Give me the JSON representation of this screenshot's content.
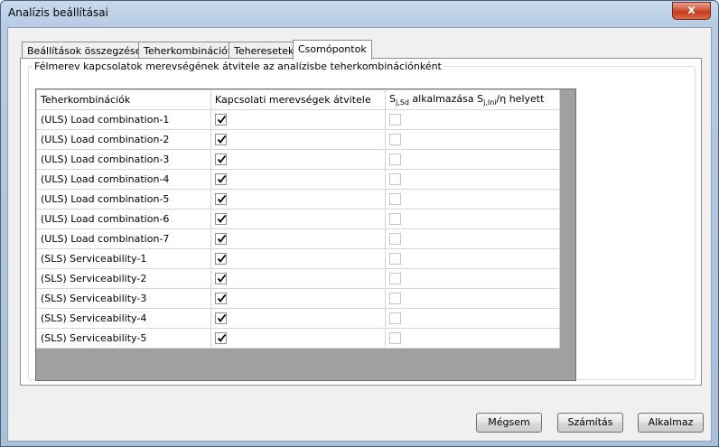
{
  "window": {
    "title": "Analízis beállításai",
    "close_glyph": "x"
  },
  "tabs": [
    {
      "label": "Beállítások összegzése",
      "active": false
    },
    {
      "label": "Teherkombinációk",
      "active": false
    },
    {
      "label": "Teheresetek",
      "active": false
    },
    {
      "label": "Csomópontok",
      "active": true
    }
  ],
  "group": {
    "legend": "Félmerev kapcsolatok merevségének átvitele az analízisbe teherkombinációnként"
  },
  "grid": {
    "columns": {
      "col1": "Teherkombinációk",
      "col2": "Kapcsolati merevségek átvitele",
      "col3_a": "S",
      "col3_sub1": "j,Sd",
      "col3_b": " alkalmazása S",
      "col3_sub2": "j,Ini",
      "col3_c": "/η helyett"
    },
    "rows": [
      {
        "name": "(ULS) Load combination-1",
        "transfer": true,
        "use_sjsd": false
      },
      {
        "name": "(ULS) Load combination-2",
        "transfer": true,
        "use_sjsd": false
      },
      {
        "name": "(ULS) Load combination-3",
        "transfer": true,
        "use_sjsd": false
      },
      {
        "name": "(ULS) Load combination-4",
        "transfer": true,
        "use_sjsd": false
      },
      {
        "name": "(ULS) Load combination-5",
        "transfer": true,
        "use_sjsd": false
      },
      {
        "name": "(ULS) Load combination-6",
        "transfer": true,
        "use_sjsd": false
      },
      {
        "name": "(ULS) Load combination-7",
        "transfer": true,
        "use_sjsd": false
      },
      {
        "name": "(SLS) Serviceability-1",
        "transfer": true,
        "use_sjsd": false
      },
      {
        "name": "(SLS) Serviceability-2",
        "transfer": true,
        "use_sjsd": false
      },
      {
        "name": "(SLS) Serviceability-3",
        "transfer": true,
        "use_sjsd": false
      },
      {
        "name": "(SLS) Serviceability-4",
        "transfer": true,
        "use_sjsd": false
      },
      {
        "name": "(SLS) Serviceability-5",
        "transfer": true,
        "use_sjsd": false
      }
    ]
  },
  "buttons": {
    "cancel": "Mégsem",
    "calculate": "Számítás",
    "apply": "Alkalmaz"
  }
}
